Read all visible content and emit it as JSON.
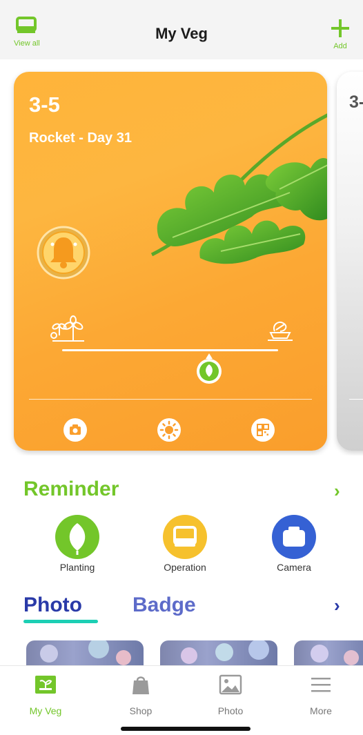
{
  "header": {
    "title": "My Veg",
    "left_label": "View all",
    "right_label": "Add",
    "accent_color": "#73c62a"
  },
  "cards": [
    {
      "slot": "3-5",
      "plant_line": "Rocket - Day 31",
      "background": "orange",
      "icons": {
        "alarm": "bell-icon",
        "start": "seedling-icon",
        "end": "harvest-icon",
        "buttons": [
          "camera-icon",
          "light-icon",
          "qr-code-icon"
        ]
      }
    },
    {
      "slot": "3-"
    }
  ],
  "reminder": {
    "title": "Reminder",
    "items": [
      {
        "label": "Planting",
        "icon": "leaf-icon",
        "color": "#73c62a"
      },
      {
        "label": "Operation",
        "icon": "device-icon",
        "color": "#f6c12d"
      },
      {
        "label": "Camera",
        "icon": "camera-icon",
        "color": "#3561d4"
      }
    ]
  },
  "media_tabs": {
    "tabs": [
      "Photo",
      "Badge"
    ],
    "active": "Photo",
    "underline_color": "#1ccfb4"
  },
  "tabbar": {
    "items": [
      {
        "label": "My Veg",
        "icon": "planter-icon",
        "active": true
      },
      {
        "label": "Shop",
        "icon": "shopping-bag-icon",
        "active": false
      },
      {
        "label": "Photo",
        "icon": "image-icon",
        "active": false
      },
      {
        "label": "More",
        "icon": "menu-icon",
        "active": false
      }
    ]
  }
}
